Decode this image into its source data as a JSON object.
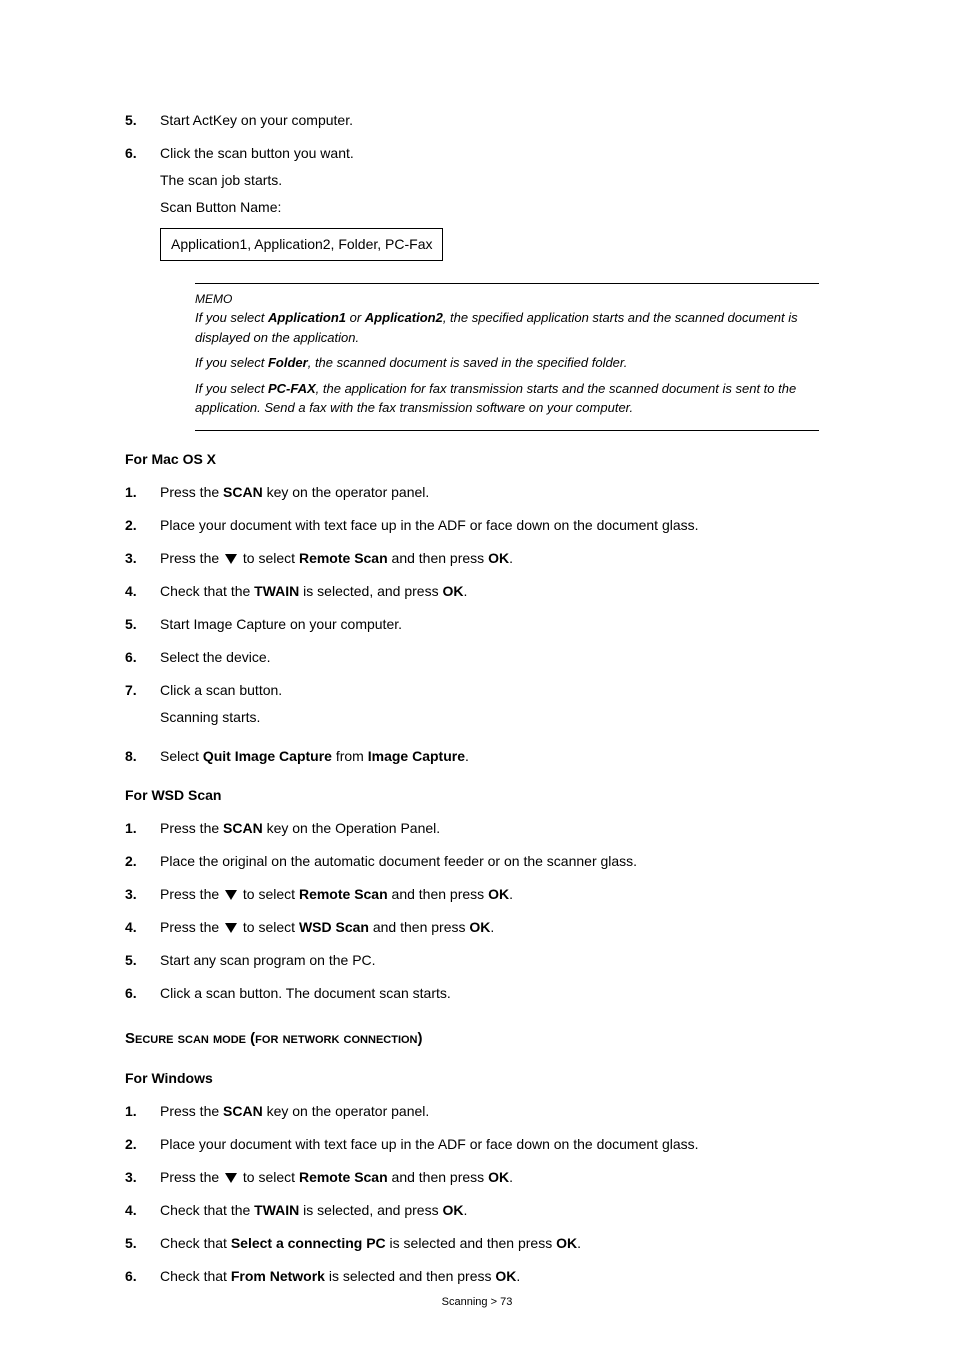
{
  "top": {
    "items": [
      {
        "num": "5.",
        "text": "Start ActKey on your computer."
      },
      {
        "num": "6.",
        "text": "Click the scan button you want.",
        "sub1": "The scan job starts.",
        "sub2": "Scan Button Name:",
        "box": "Application1, Application2, Folder, PC-Fax"
      }
    ]
  },
  "memo": {
    "title": "MEMO",
    "p1_pre": "If you select ",
    "p1_b1": "Application1",
    "p1_mid": " or ",
    "p1_b2": "Application2",
    "p1_post": ", the specified application starts and the scanned document is displayed on the application.",
    "p2_pre": "If you select ",
    "p2_b": "Folder",
    "p2_post": ", the scanned document is saved in the specified folder.",
    "p3_pre": "If you select ",
    "p3_b": "PC-FAX",
    "p3_post": ", the application for fax transmission starts and the scanned document is sent to the application. Send a fax with the fax transmission software on your computer."
  },
  "mac": {
    "heading": "For Mac OS X",
    "items": [
      {
        "num": "1.",
        "pre": "Press the ",
        "b": "SCAN",
        "post": " key on the operator panel."
      },
      {
        "num": "2.",
        "text": "Place your document with text face up in the ADF or face down on the document glass."
      },
      {
        "num": "3.",
        "pre": "Press the ",
        "tri": true,
        "mid": " to select ",
        "b": "Remote Scan",
        "mid2": " and then press ",
        "b2": "OK",
        "post": "."
      },
      {
        "num": "4.",
        "pre": "Check that the ",
        "b": "TWAIN",
        "mid2": " is selected, and press ",
        "b2": "OK",
        "post": "."
      },
      {
        "num": "5.",
        "text": "Start Image Capture on your computer."
      },
      {
        "num": "6.",
        "text": "Select the device."
      },
      {
        "num": "7.",
        "text": "Click a scan button.",
        "sub1": "Scanning starts."
      },
      {
        "num": "8.",
        "pre": "Select ",
        "b": "Quit Image Capture",
        "mid2": " from ",
        "b2": "Image Capture",
        "post": "."
      }
    ]
  },
  "wsd": {
    "heading": "For WSD Scan",
    "items": [
      {
        "num": "1.",
        "pre": "Press the ",
        "b": "SCAN",
        "post": " key on the Operation Panel."
      },
      {
        "num": "2.",
        "text": "Place the original on the automatic document feeder or on the scanner glass."
      },
      {
        "num": "3.",
        "pre": "Press the ",
        "tri": true,
        "mid": " to select ",
        "b": "Remote Scan",
        "mid2": " and then press ",
        "b2": "OK",
        "post": "."
      },
      {
        "num": "4.",
        "pre": "Press the ",
        "tri": true,
        "mid": " to select ",
        "b": "WSD Scan",
        "mid2": " and then press ",
        "b2": "OK",
        "post": "."
      },
      {
        "num": "5.",
        "text": "Start any scan program on the PC."
      },
      {
        "num": "6.",
        "text": "Click a scan button. The document scan starts."
      }
    ]
  },
  "secure": {
    "heading": "Secure scan mode (for network connection)"
  },
  "windows": {
    "heading": "For Windows",
    "items": [
      {
        "num": "1.",
        "pre": "Press the ",
        "b": "SCAN",
        "post": " key on the operator panel."
      },
      {
        "num": "2.",
        "text": "Place your document with text face up in the ADF or face down on the document glass."
      },
      {
        "num": "3.",
        "pre": "Press the ",
        "tri": true,
        "mid": " to select ",
        "b": "Remote Scan",
        "mid2": " and then press ",
        "b2": "OK",
        "post": "."
      },
      {
        "num": "4.",
        "pre": "Check that the ",
        "b": "TWAIN",
        "mid2": " is selected, and press ",
        "b2": "OK",
        "post": "."
      },
      {
        "num": "5.",
        "pre": "Check that ",
        "b": "Select a connecting PC",
        "mid2": " is selected and then press ",
        "b2": "OK",
        "post": "."
      },
      {
        "num": "6.",
        "pre": "Check that ",
        "b": "From Network",
        "mid2": " is selected and then press ",
        "b2": "OK",
        "post": "."
      }
    ]
  },
  "footer": "Scanning > 73"
}
